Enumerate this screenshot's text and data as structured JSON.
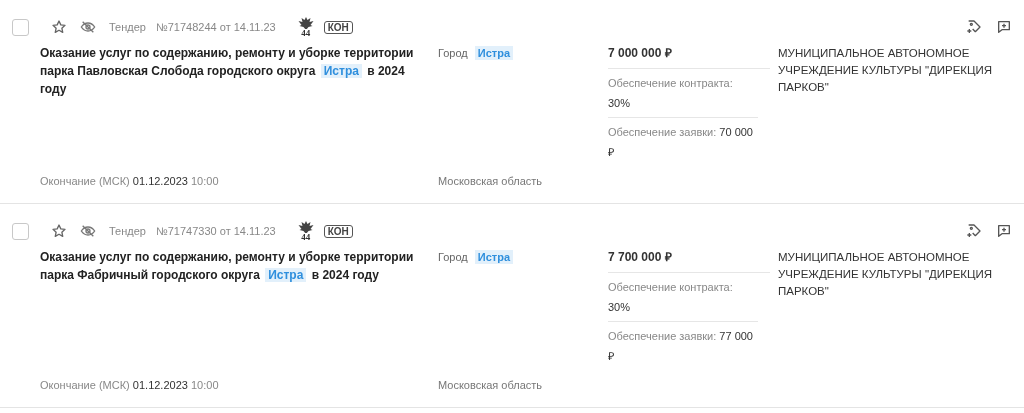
{
  "tenders": [
    {
      "checked": false,
      "starred": false,
      "type": "Тендер",
      "number": "№71748244 от 14.11.23",
      "law": "44",
      "badge": "КОН",
      "title": [
        {
          "text": "Оказание услуг по содержанию, ремонту и уборке территории парка Павловская Слобода городского округа ",
          "highlight": false
        },
        {
          "text": "Истра",
          "highlight": true
        },
        {
          "text": " в 2024 году",
          "highlight": false
        }
      ],
      "city_label": "Город",
      "city": "Истра",
      "region": "Московская область",
      "price": "7 000 000 ₽",
      "contract_label": "Обеспечение контракта:",
      "contract_value": "30%",
      "bid_label": "Обеспечение заявки:",
      "bid_value": "70 000 ₽",
      "customer": "МУНИЦИПАЛЬНОЕ АВТОНОМНОЕ УЧРЕЖДЕНИЕ КУЛЬТУРЫ \"ДИРЕКЦИЯ ПАРКОВ\"",
      "end_label": "Окончание (МСК)",
      "end_date": "01.12.2023",
      "end_time": "10:00"
    },
    {
      "checked": false,
      "starred": false,
      "type": "Тендер",
      "number": "№71747330 от 14.11.23",
      "law": "44",
      "badge": "КОН",
      "title": [
        {
          "text": "Оказание услуг по содержанию, ремонту и уборке территории парка Фабричный городского округа ",
          "highlight": false
        },
        {
          "text": "Истра",
          "highlight": true
        },
        {
          "text": " в 2024 году",
          "highlight": false
        }
      ],
      "city_label": "Город",
      "city": "Истра",
      "region": "Московская область",
      "price": "7 700 000 ₽",
      "contract_label": "Обеспечение контракта:",
      "contract_value": "30%",
      "bid_label": "Обеспечение заявки:",
      "bid_value": "77 000 ₽",
      "customer": "МУНИЦИПАЛЬНОЕ АВТОНОМНОЕ УЧРЕЖДЕНИЕ КУЛЬТУРЫ \"ДИРЕКЦИЯ ПАРКОВ\"",
      "end_label": "Окончание (МСК)",
      "end_date": "01.12.2023",
      "end_time": "10:00"
    }
  ]
}
